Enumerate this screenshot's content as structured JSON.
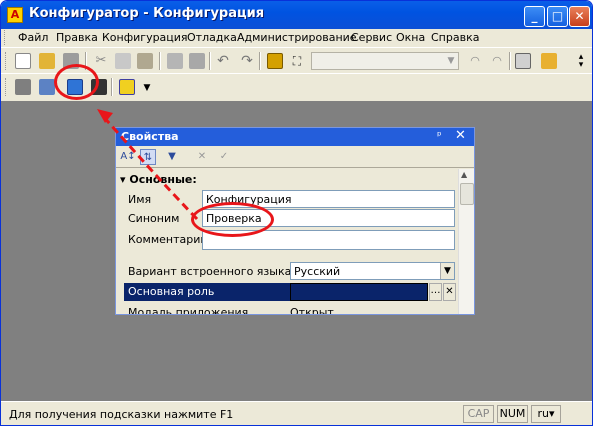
{
  "window": {
    "title": "Конфигуратор - Конфигурация",
    "app_icon_letter": "А",
    "minimize": "_",
    "maximize": "□",
    "close": "✕"
  },
  "menu": [
    {
      "label": "Файл"
    },
    {
      "label": "Правка"
    },
    {
      "label": "Конфигурация"
    },
    {
      "label": "Отладка"
    },
    {
      "label": "Администрирование"
    },
    {
      "label": "Сервис"
    },
    {
      "label": "Окна"
    },
    {
      "label": "Справка"
    }
  ],
  "toolbar": {
    "icons": [
      "new-icon",
      "open-icon",
      "save-icon",
      "cut-icon",
      "copy-icon",
      "paste-icon",
      "print-icon",
      "preview-icon",
      "undo-icon",
      "redo-icon",
      "find-icon",
      "binoculars-icon",
      "search-combo",
      "window-icon",
      "wizard-icon"
    ],
    "search_value": ""
  },
  "toolbar2": {
    "icons": [
      "compare-icon",
      "update-icon",
      "properties-icon",
      "module-icon",
      "toolbar-dropdown-icon"
    ]
  },
  "properties_panel": {
    "title": "Свойства",
    "pin": "ᵖ",
    "close": "✕",
    "tool_icons": [
      "sort-az-icon",
      "sort-categories-icon",
      "filter-icon",
      "clear-icon",
      "apply-icon"
    ],
    "section": "Основные:",
    "fields": {
      "name_label": "Имя",
      "name_value": "Конфигурация",
      "synonym_label": "Синоним",
      "synonym_value": "Проверка",
      "comment_label": "Комментарий",
      "comment_value": "",
      "language_label": "Вариант встроенного языка",
      "language_value": "Русский",
      "role_label": "Основная роль",
      "role_value": "",
      "mode_label": "Модаль приложения",
      "mode_value": "Открыт"
    }
  },
  "status": {
    "text": "Для получения подсказки нажмите F1",
    "cap": "CAP",
    "num": "NUM",
    "lang": "ru"
  },
  "colors": {
    "title_blue": "#0a5fe8",
    "panel_title": "#245edb",
    "workspace": "#808080",
    "selection": "#0a246a",
    "annotation": "#e8161a"
  }
}
